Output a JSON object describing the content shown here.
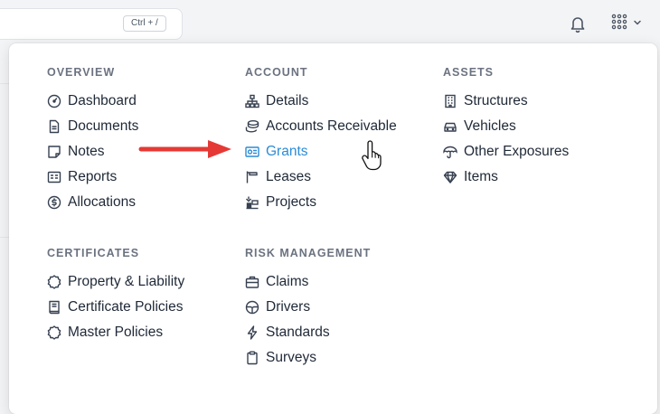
{
  "topbar": {
    "search_shortcut": "Ctrl + /"
  },
  "menu": {
    "sections": [
      {
        "title": "OVERVIEW",
        "items": [
          "Dashboard",
          "Documents",
          "Notes",
          "Reports",
          "Allocations"
        ]
      },
      {
        "title": "ACCOUNT",
        "items": [
          "Details",
          "Accounts Receivable",
          "Grants",
          "Leases",
          "Projects"
        ]
      },
      {
        "title": "ASSETS",
        "items": [
          "Structures",
          "Vehicles",
          "Other Exposures",
          "Items"
        ]
      },
      {
        "title": "CERTIFICATES",
        "items": [
          "Property & Liability",
          "Certificate Policies",
          "Master Policies"
        ]
      },
      {
        "title": "RISK MANAGEMENT",
        "items": [
          "Claims",
          "Drivers",
          "Standards",
          "Surveys"
        ]
      }
    ],
    "active_item": "Grants"
  },
  "colors": {
    "accent": "#2b8cd8",
    "annotation_arrow": "#e53935",
    "section_title": "#6b7280"
  }
}
